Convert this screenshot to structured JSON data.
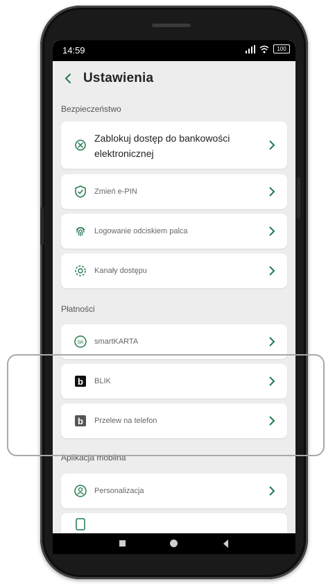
{
  "status": {
    "time": "14:59",
    "battery": "100"
  },
  "header": {
    "title": "Ustawienia"
  },
  "sections": {
    "security": {
      "title": "Bezpieczeństwo",
      "items": [
        {
          "label_line1": "Zablokuj dostęp do bankowości",
          "label_line2": "elektronicznej",
          "icon": "block-icon"
        },
        {
          "label": "Zmień e-PIN",
          "icon": "shield-check-icon"
        },
        {
          "label": "Logowanie odciskiem palca",
          "icon": "fingerprint-icon"
        },
        {
          "label": "Kanały dostępu",
          "icon": "gear-icon"
        }
      ]
    },
    "payments": {
      "title": "Płatności",
      "items": [
        {
          "label": "smartKARTA",
          "icon": "smartkarta-icon"
        },
        {
          "label": "BLIK",
          "icon": "blik-icon"
        },
        {
          "label": "Przelew na telefon",
          "icon": "blik-phone-icon"
        }
      ]
    },
    "mobile": {
      "title": "Aplikacja mobilna",
      "items": [
        {
          "label": "Personalizacja",
          "icon": "user-circle-icon"
        },
        {
          "label": "",
          "icon": "device-icon"
        }
      ]
    }
  },
  "colors": {
    "accent": "#1f7a4d",
    "card": "#ffffff",
    "background": "#ededed"
  }
}
